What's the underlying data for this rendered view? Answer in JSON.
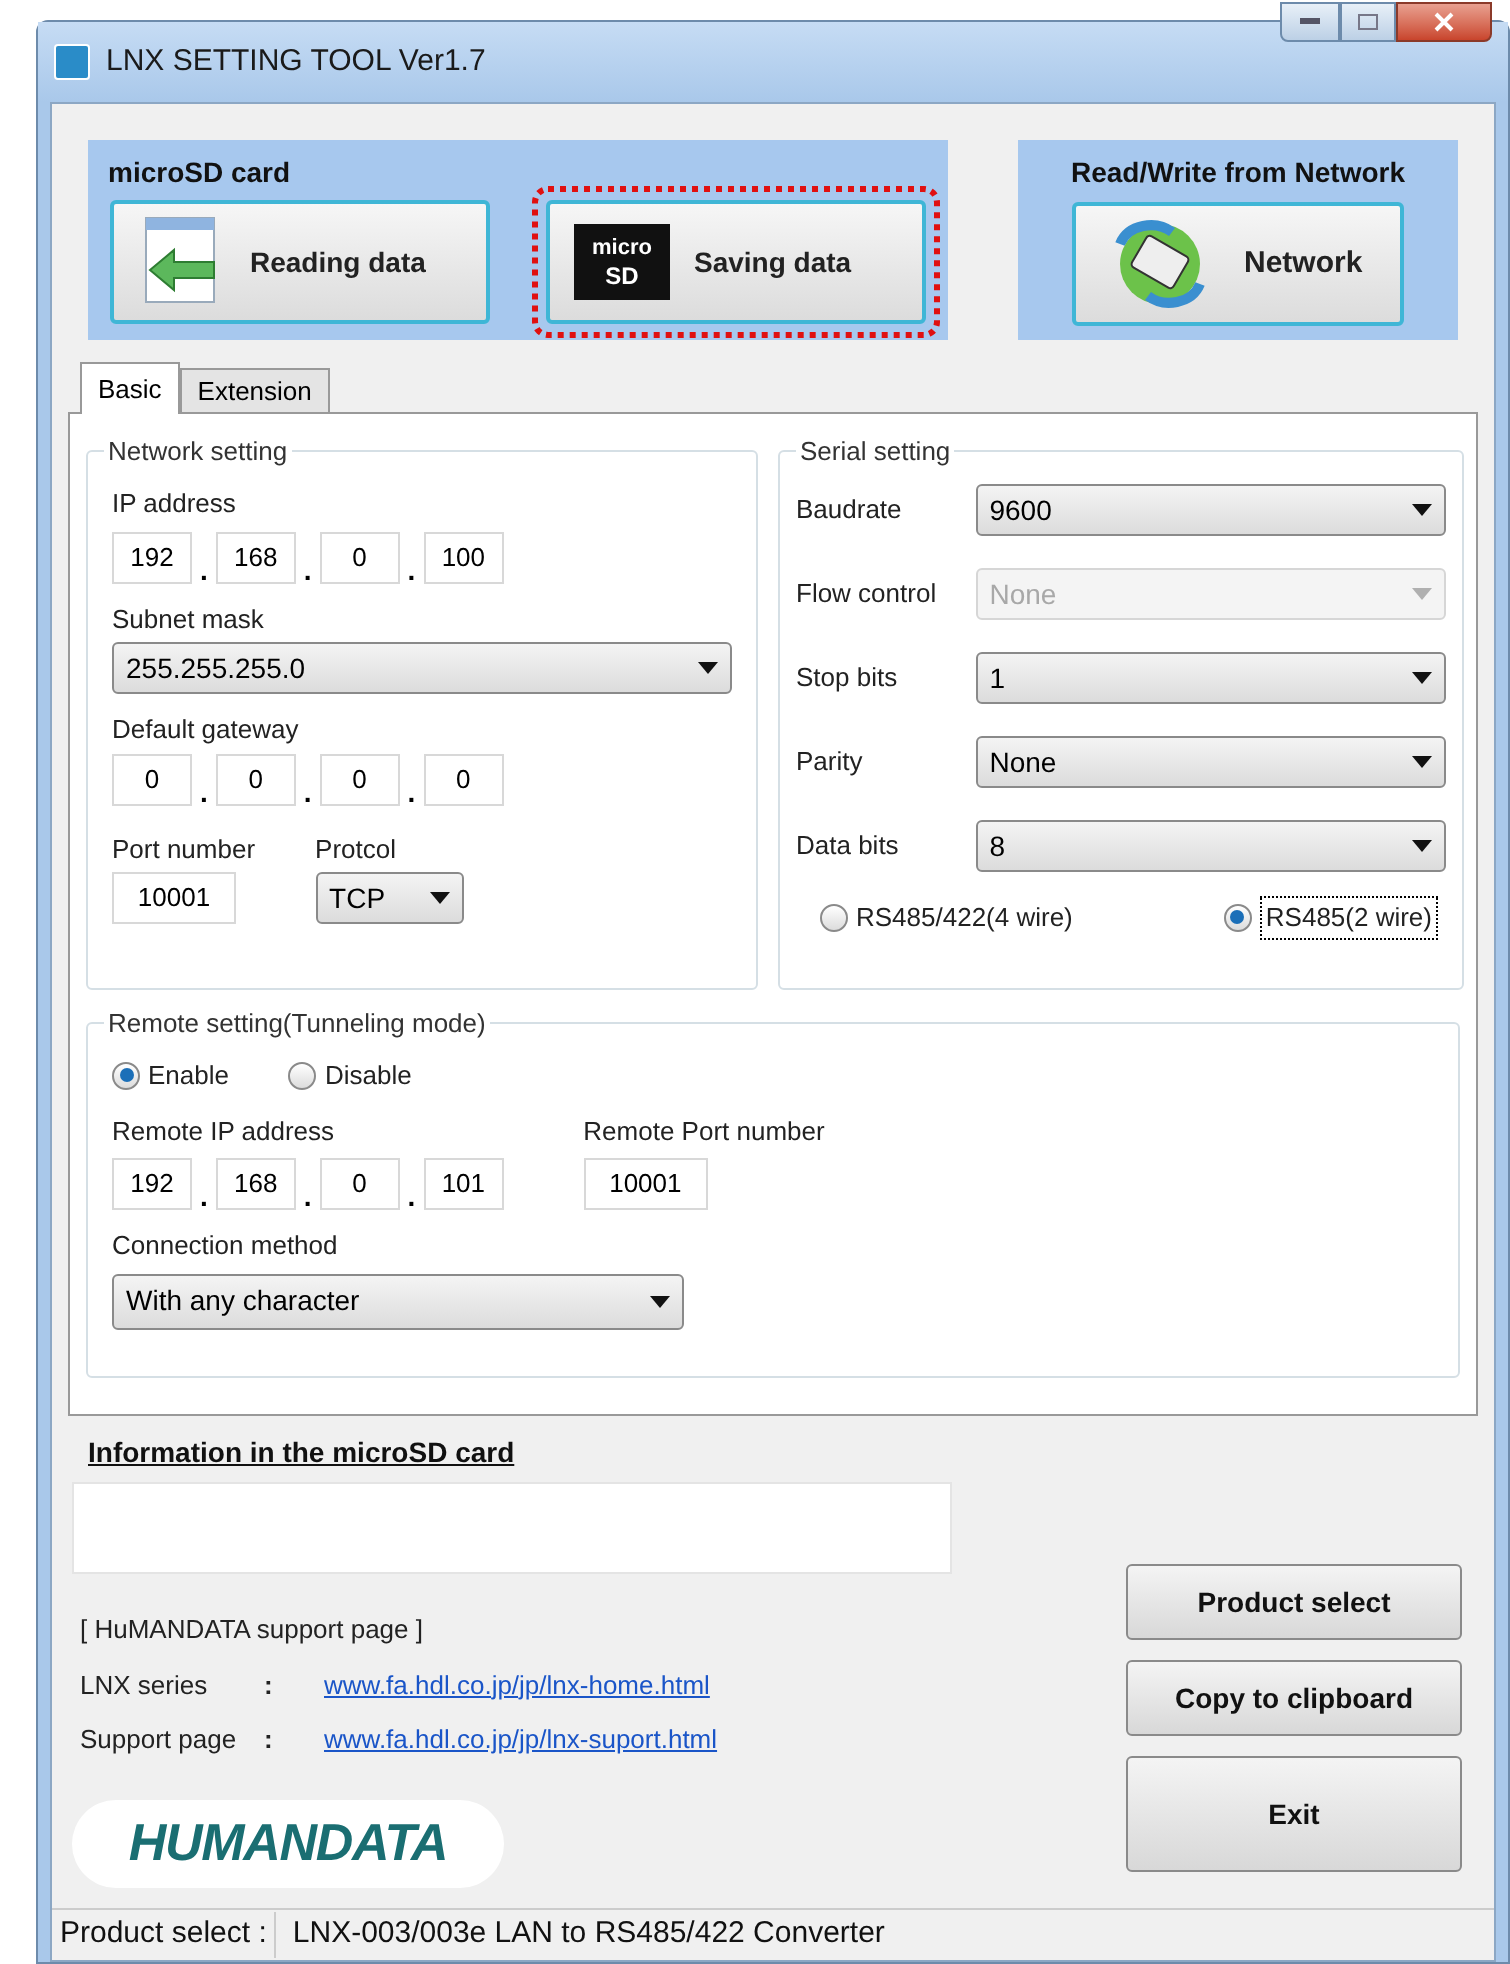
{
  "window": {
    "title": "LNX SETTING TOOL Ver1.7"
  },
  "microsd_group": {
    "title": "microSD card",
    "buttons": [
      {
        "label": "Reading data",
        "kind": "reading",
        "highlighted": false
      },
      {
        "label": "Saving data",
        "kind": "sd",
        "highlighted": true,
        "icon_text": [
          "micro",
          "SD"
        ]
      }
    ]
  },
  "network_group": {
    "title": "Read/Write from Network",
    "button": {
      "label": "Network"
    }
  },
  "tabs": [
    {
      "label": "Basic",
      "selected": true
    },
    {
      "label": "Extension",
      "selected": false
    }
  ],
  "network_setting": {
    "title": "Network setting",
    "ip_address": {
      "label": "IP address",
      "octets": [
        "192",
        "168",
        "0",
        "100"
      ],
      "separators": [
        ".",
        ".",
        "."
      ]
    },
    "subnet_mask": {
      "label": "Subnet mask",
      "value": "255.255.255.0"
    },
    "default_gateway": {
      "label": "Default gateway",
      "octets": [
        "0",
        "0",
        "0",
        "0"
      ],
      "separators": [
        ".",
        ".",
        "."
      ]
    },
    "port_number": {
      "label": "Port number",
      "value": "10001"
    },
    "protocol": {
      "label": "Protcol",
      "value": "TCP"
    }
  },
  "serial_setting": {
    "title": "Serial setting",
    "fields": [
      {
        "label": "Baudrate",
        "value": "9600",
        "disabled": false
      },
      {
        "label": "Flow control",
        "value": "None",
        "disabled": true
      },
      {
        "label": "Stop bits",
        "value": "1",
        "disabled": false
      },
      {
        "label": "Parity",
        "value": "None",
        "disabled": false
      },
      {
        "label": "Data bits",
        "value": "8",
        "disabled": false
      }
    ],
    "modes": [
      {
        "label": "RS485/422(4 wire)",
        "selected": false
      },
      {
        "label": "RS485(2 wire)",
        "selected": true
      }
    ]
  },
  "remote_setting": {
    "title": "Remote setting(Tunneling mode)",
    "modes": [
      {
        "label": "Enable",
        "selected": true
      },
      {
        "label": "Disable",
        "selected": false
      }
    ],
    "remote_ip": {
      "label": "Remote IP address",
      "octets": [
        "192",
        "168",
        "0",
        "101"
      ],
      "separators": [
        ".",
        ".",
        "."
      ]
    },
    "remote_port": {
      "label": "Remote Port number",
      "value": "10001"
    },
    "connection_method": {
      "label": "Connection method",
      "value": "With any character"
    }
  },
  "info": {
    "title": "Information in the microSD card"
  },
  "support": {
    "heading": "[ HuMANDATA support page ]",
    "links": [
      {
        "label": "LNX series",
        "colon": ":",
        "url": "www.fa.hdl.co.jp/jp/lnx-home.html"
      },
      {
        "label": "Support page",
        "colon": ":",
        "url": "www.fa.hdl.co.jp/jp/lnx-suport.html"
      }
    ]
  },
  "logo": {
    "text": "HUMANDATA"
  },
  "buttons": [
    {
      "label": "Product select",
      "kind": "small"
    },
    {
      "label": "Copy to clipboard",
      "kind": "small"
    },
    {
      "label": "Exit",
      "kind": "large"
    }
  ],
  "status_bar": {
    "label": "Product select :",
    "value": "LNX-003/003e LAN to RS485/422 Converter"
  }
}
